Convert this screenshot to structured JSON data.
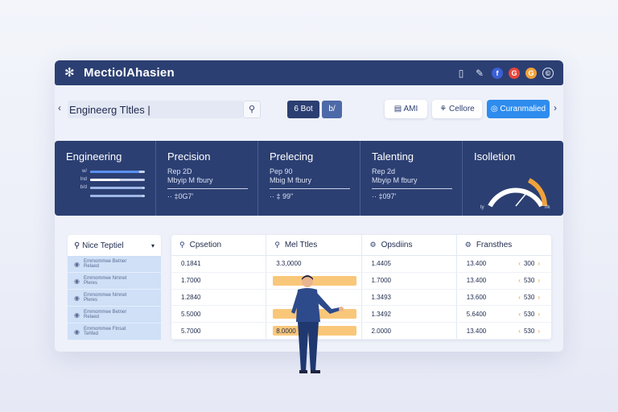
{
  "window": {
    "title": "MectiolAhasien",
    "logo_icon": "snowflake-icon",
    "toolbar_icons": [
      "clipboard-icon",
      "pen-icon"
    ],
    "social": [
      {
        "icon": "facebook-icon",
        "glyph": "f",
        "color": "#3b5fd6"
      },
      {
        "icon": "google-icon",
        "glyph": "G",
        "color": "#e8463c"
      },
      {
        "icon": "circle-orange-icon",
        "glyph": "G",
        "color": "#f0a23a"
      },
      {
        "icon": "copyright-icon",
        "glyph": "©",
        "color": "#2c3f72"
      }
    ]
  },
  "toolbar": {
    "back": "‹",
    "search_value": "Engineerg Tltles  |",
    "search_icon": "search-icon",
    "btn1": "6 Bot",
    "btn2": "b/",
    "btn_aml": "AMI",
    "btn_cellore": "Cellore",
    "btn_primary": "Curanmalied",
    "forward": "›"
  },
  "cards": [
    {
      "title": "Engineering",
      "bars": [
        {
          "label": "w/",
          "value": 0.9
        },
        {
          "label": "lnd",
          "value": 0.55
        },
        {
          "label": "b/d",
          "value": 0.95
        },
        {
          "label": "",
          "value": 0.95
        }
      ]
    },
    {
      "title": "Precision",
      "line1": "Rep 2D",
      "line2": "Mbyip M fbury",
      "value": "·· ‡0G7'"
    },
    {
      "title": "Prelecing",
      "line1": "Pep 90",
      "line2": "Mbig M fbury",
      "value": "·· ‡ 99\""
    },
    {
      "title": "Talenting",
      "line1": "Rep 2d",
      "line2": "Mbyip M fbury",
      "value": "·· ‡097'"
    },
    {
      "title": "Isolletion",
      "gauge_value": 0.72,
      "gauge_left": "ty",
      "gauge_right": "f/k"
    }
  ],
  "list": {
    "header": "Nice Teptiel",
    "items": [
      {
        "line1": "Emmommee Betner",
        "line2": "Relaed"
      },
      {
        "line1": "Emmommee Nmnet",
        "line2": "Pleres"
      },
      {
        "line1": "Emmommee Nmnet",
        "line2": "Pleres"
      },
      {
        "line1": "Emmommee Betner",
        "line2": "Relaed"
      },
      {
        "line1": "Emmommee Ftnsat",
        "line2": "Tehfed"
      }
    ]
  },
  "table": {
    "headers": [
      {
        "icon": "search-icon",
        "label": "Cpsetion"
      },
      {
        "icon": "search-icon",
        "label": "Mel Ttles"
      },
      {
        "icon": "gear-icon",
        "label": "Opsdiins"
      },
      {
        "icon": "gear-icon",
        "label": "Fransthes"
      }
    ],
    "rows": [
      {
        "c1": "0.1841",
        "c2": "3.3,0000",
        "c3": "1.4405",
        "c4": "13.400",
        "step": "300",
        "hl": false
      },
      {
        "c1": "1.7000",
        "c2": "",
        "c3": "1.7000",
        "c4": "13.400",
        "step": "530",
        "hl": true
      },
      {
        "c1": "1.2840",
        "c2": "",
        "c3": "1.3493",
        "c4": "13.600",
        "step": "530",
        "hl": false
      },
      {
        "c1": "5.5000",
        "c2": "",
        "c3": "1.3492",
        "c4": "5.6400",
        "step": "530",
        "hl": true
      },
      {
        "c1": "5.7000",
        "c2": "8.0000",
        "c3": "2.0000",
        "c4": "13.400",
        "step": "530",
        "hl": true
      }
    ]
  },
  "colors": {
    "navy": "#2c3f72",
    "accent": "#2d8cee",
    "highlight": "#f9c77a"
  }
}
